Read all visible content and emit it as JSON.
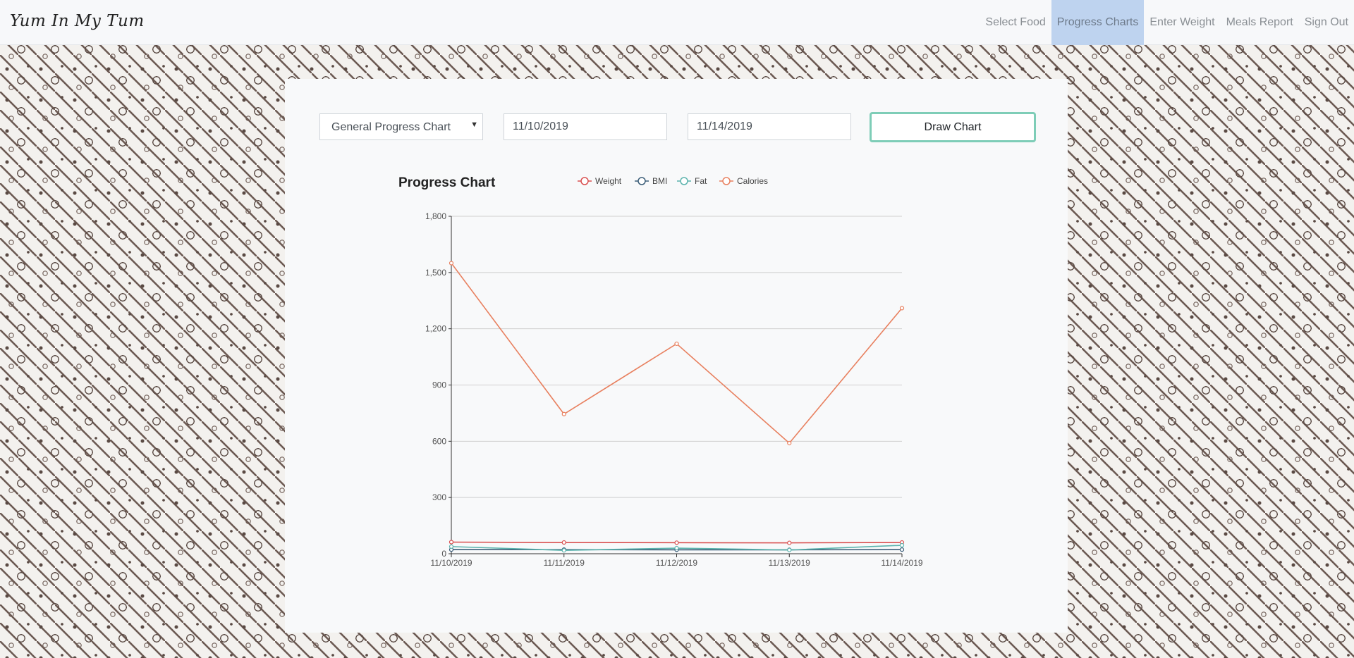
{
  "app": {
    "brand": "Yum In My Tum"
  },
  "nav": {
    "items": [
      {
        "label": "Select Food",
        "active": false
      },
      {
        "label": "Progress Charts",
        "active": true
      },
      {
        "label": "Enter Weight",
        "active": false
      },
      {
        "label": "Meals Report",
        "active": false
      },
      {
        "label": "Sign Out",
        "active": false
      }
    ]
  },
  "controls": {
    "chart_type": "General Progress Chart",
    "start_date": "11/10/2019",
    "end_date": "11/14/2019",
    "draw_button": "Draw Chart"
  },
  "chart_data": {
    "type": "line",
    "title": "Progress Chart",
    "x": [
      "11/10/2019",
      "11/11/2019",
      "11/12/2019",
      "11/13/2019",
      "11/14/2019"
    ],
    "ylim": [
      0,
      1800
    ],
    "yticks": [
      0,
      300,
      600,
      900,
      1200,
      1500,
      1800
    ],
    "grid": true,
    "legend_position": "top",
    "series": [
      {
        "name": "Weight",
        "color": "#d94f4f",
        "values": [
          62,
          60,
          59,
          58,
          60
        ]
      },
      {
        "name": "BMI",
        "color": "#3a5d78",
        "values": [
          22,
          22,
          21,
          21,
          22
        ]
      },
      {
        "name": "Fat",
        "color": "#5bb3ad",
        "values": [
          38,
          18,
          30,
          20,
          45
        ]
      },
      {
        "name": "Calories",
        "color": "#e8805f",
        "values": [
          1550,
          745,
          1120,
          590,
          1310
        ]
      }
    ]
  }
}
